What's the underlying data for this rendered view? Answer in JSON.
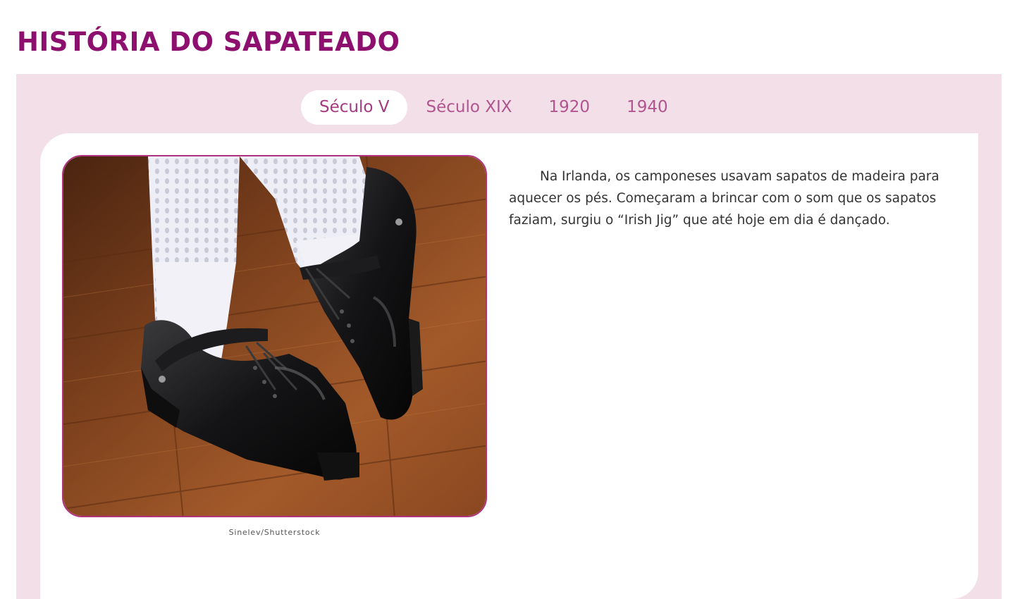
{
  "page": {
    "title": "HISTÓRIA DO SAPATEADO"
  },
  "tabs": [
    {
      "label": "Século V",
      "active": true
    },
    {
      "label": "Século XIX",
      "active": false
    },
    {
      "label": "1920",
      "active": false
    },
    {
      "label": "1940",
      "active": false
    }
  ],
  "content": {
    "image_credit": "Sinelev/Shutterstock",
    "paragraph": "Na Irlanda, os camponeses usavam sapatos de madeira para aquecer os pés. Começaram a brincar com o som que os sapatos faziam, surgiu o “Irish Jig” que até hoje em dia é dançado."
  },
  "colors": {
    "title": "#8d0f6e",
    "panel_background": "#f2dfe8",
    "tab_text": "#b0558f",
    "image_border": "#b0317e"
  }
}
